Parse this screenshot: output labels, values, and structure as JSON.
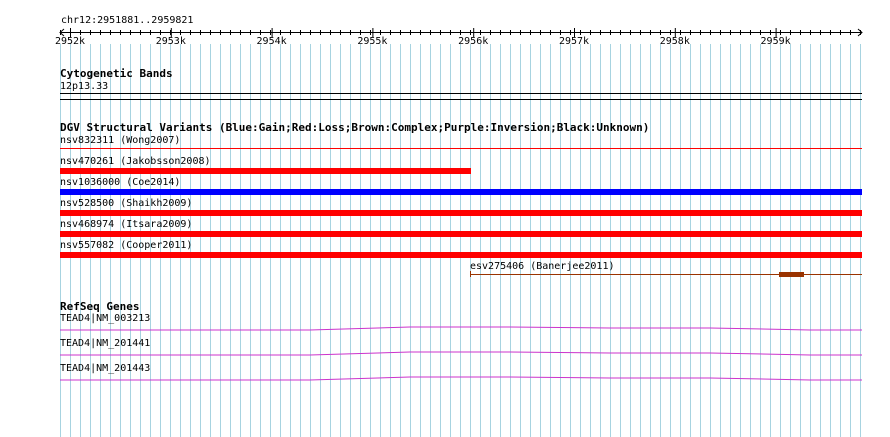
{
  "colors": {
    "grid_line": "#a7d3e0",
    "gain": "#0000ff",
    "loss": "#ff0000",
    "complex": "#993300",
    "gene": "#cc33cc",
    "axis": "#000000"
  },
  "ruler": {
    "location": "chr12:2951881..2959821",
    "ticks": [
      "2952k",
      "2953k",
      "2954k",
      "2955k",
      "2956k",
      "2957k",
      "2958k",
      "2959k"
    ]
  },
  "cytoband_track": {
    "title": "Cytogenetic Bands",
    "band": "12p13.33"
  },
  "dgv_track": {
    "title": "DGV Structural Variants (Blue:Gain;Red:Loss;Brown:Complex;Purple:Inversion;Black:Unknown)",
    "features": [
      {
        "label": "nsv832311 (Wong2007)",
        "type": "Loss"
      },
      {
        "label": "nsv470261 (Jakobsson2008)",
        "type": "Loss"
      },
      {
        "label": "nsv1036000 (Coe2014)",
        "type": "Gain"
      },
      {
        "label": "nsv528500 (Shaikh2009)",
        "type": "Loss"
      },
      {
        "label": "nsv468974 (Itsara2009)",
        "type": "Loss"
      },
      {
        "label": "nsv557082 (Cooper2011)",
        "type": "Loss"
      },
      {
        "label": "esv275406 (Banerjee2011)",
        "type": "Complex"
      }
    ]
  },
  "refseq_track": {
    "title": "RefSeq Genes",
    "genes": [
      {
        "label": "TEAD4|NM_003213"
      },
      {
        "label": "TEAD4|NM_201441"
      },
      {
        "label": "TEAD4|NM_201443"
      }
    ]
  }
}
